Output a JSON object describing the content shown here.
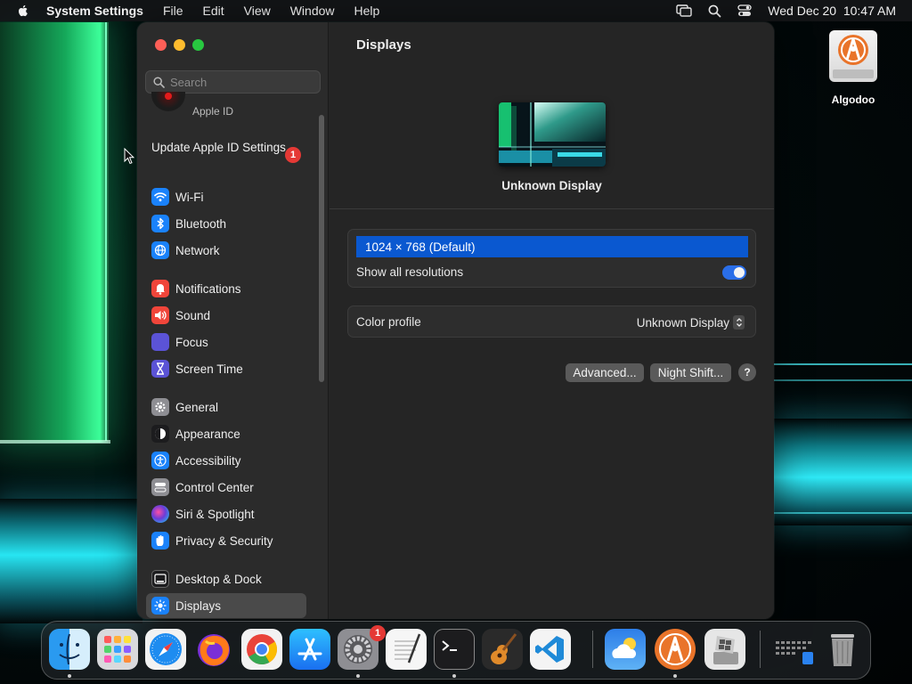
{
  "menubar": {
    "app_name": "System Settings",
    "menus": [
      "File",
      "Edit",
      "View",
      "Window",
      "Help"
    ],
    "clock": "Wed Dec 20  10:47 AM"
  },
  "sidebar": {
    "search_placeholder": "Search",
    "apple_id_label": "Apple ID",
    "update_label": "Update Apple ID Settings",
    "update_badge": "1",
    "items": [
      {
        "label": "Wi-Fi",
        "icon": "wifi-icon",
        "color": "#1a82fb"
      },
      {
        "label": "Bluetooth",
        "icon": "bluetooth-icon",
        "color": "#1a82fb"
      },
      {
        "label": "Network",
        "icon": "globe-icon",
        "color": "#1a82fb"
      },
      {
        "label": "Notifications",
        "icon": "bell-icon",
        "color": "#f0453a"
      },
      {
        "label": "Sound",
        "icon": "speaker-icon",
        "color": "#f0453a"
      },
      {
        "label": "Focus",
        "icon": "moon-icon",
        "color": "#5b53d6"
      },
      {
        "label": "Screen Time",
        "icon": "hourglass-icon",
        "color": "#5b53d6"
      },
      {
        "label": "General",
        "icon": "gear-icon",
        "color": "#8e8e93"
      },
      {
        "label": "Appearance",
        "icon": "appearance-icon",
        "color": "#1c1c1e"
      },
      {
        "label": "Accessibility",
        "icon": "accessibility-icon",
        "color": "#1a82fb"
      },
      {
        "label": "Control Center",
        "icon": "control-center-icon",
        "color": "#8e8e93"
      },
      {
        "label": "Siri & Spotlight",
        "icon": "siri-icon",
        "color": "#6b3cd8"
      },
      {
        "label": "Privacy & Security",
        "icon": "hand-icon",
        "color": "#1a82fb"
      },
      {
        "label": "Desktop & Dock",
        "icon": "dock-icon",
        "color": "#1c1c1e"
      },
      {
        "label": "Displays",
        "icon": "sun-icon",
        "color": "#1a82fb"
      }
    ],
    "selected": "Displays"
  },
  "main": {
    "title": "Displays",
    "display_name": "Unknown Display",
    "resolution_selected": "1024 × 768 (Default)",
    "show_all_label": "Show all resolutions",
    "show_all_on": true,
    "color_profile_label": "Color profile",
    "color_profile_value": "Unknown Display",
    "advanced_button": "Advanced...",
    "night_shift_button": "Night Shift...",
    "help_button": "?"
  },
  "desktop": {
    "icon_label": "Algodoo"
  },
  "dock": {
    "apps": [
      "Finder",
      "Launchpad",
      "Safari",
      "Firefox",
      "Chrome",
      "App Store",
      "System Settings",
      "TextEdit",
      "Terminal",
      "GarageBand",
      "Visual Studio Code",
      "Weather",
      "Algodoo",
      "Boot Camp Assistant",
      "Downloads",
      "Trash"
    ],
    "settings_badge": "1"
  },
  "colors": {
    "accent": "#0a58d0",
    "toggle": "#2a6ee8",
    "badge": "#e53935"
  }
}
